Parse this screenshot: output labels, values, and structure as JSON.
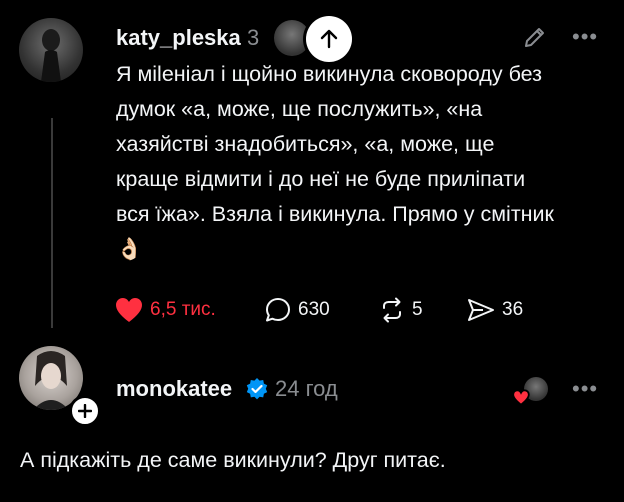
{
  "post": {
    "username": "katy_pleska",
    "time_partial": "3",
    "text": "Я мileніал і щойно викинула сковороду без думок «а, може, ще послужить», «на хазяйстві знадобиться», «а, може, ще краще відмити і до неї не буде приліпати вся їжа». Взяла і викинула. Прямо у смітник 👌🏻",
    "likes": "6,5 тис.",
    "comments": "630",
    "reposts": "5",
    "shares": "36",
    "accent_color": "#ff3040"
  },
  "reply": {
    "username": "monokatee",
    "time": "24 год",
    "text": "А підкажіть де саме викинули? Друг питає.",
    "verified_color": "#0095f6"
  },
  "icons": {
    "scroll_up": "arrow-up-icon",
    "edit": "pencil-icon",
    "more": "more-dots-icon",
    "like": "heart-icon",
    "comment": "speech-bubble-icon",
    "repost": "repost-icon",
    "share": "send-icon",
    "follow": "plus-icon",
    "verified": "verified-badge-icon"
  }
}
